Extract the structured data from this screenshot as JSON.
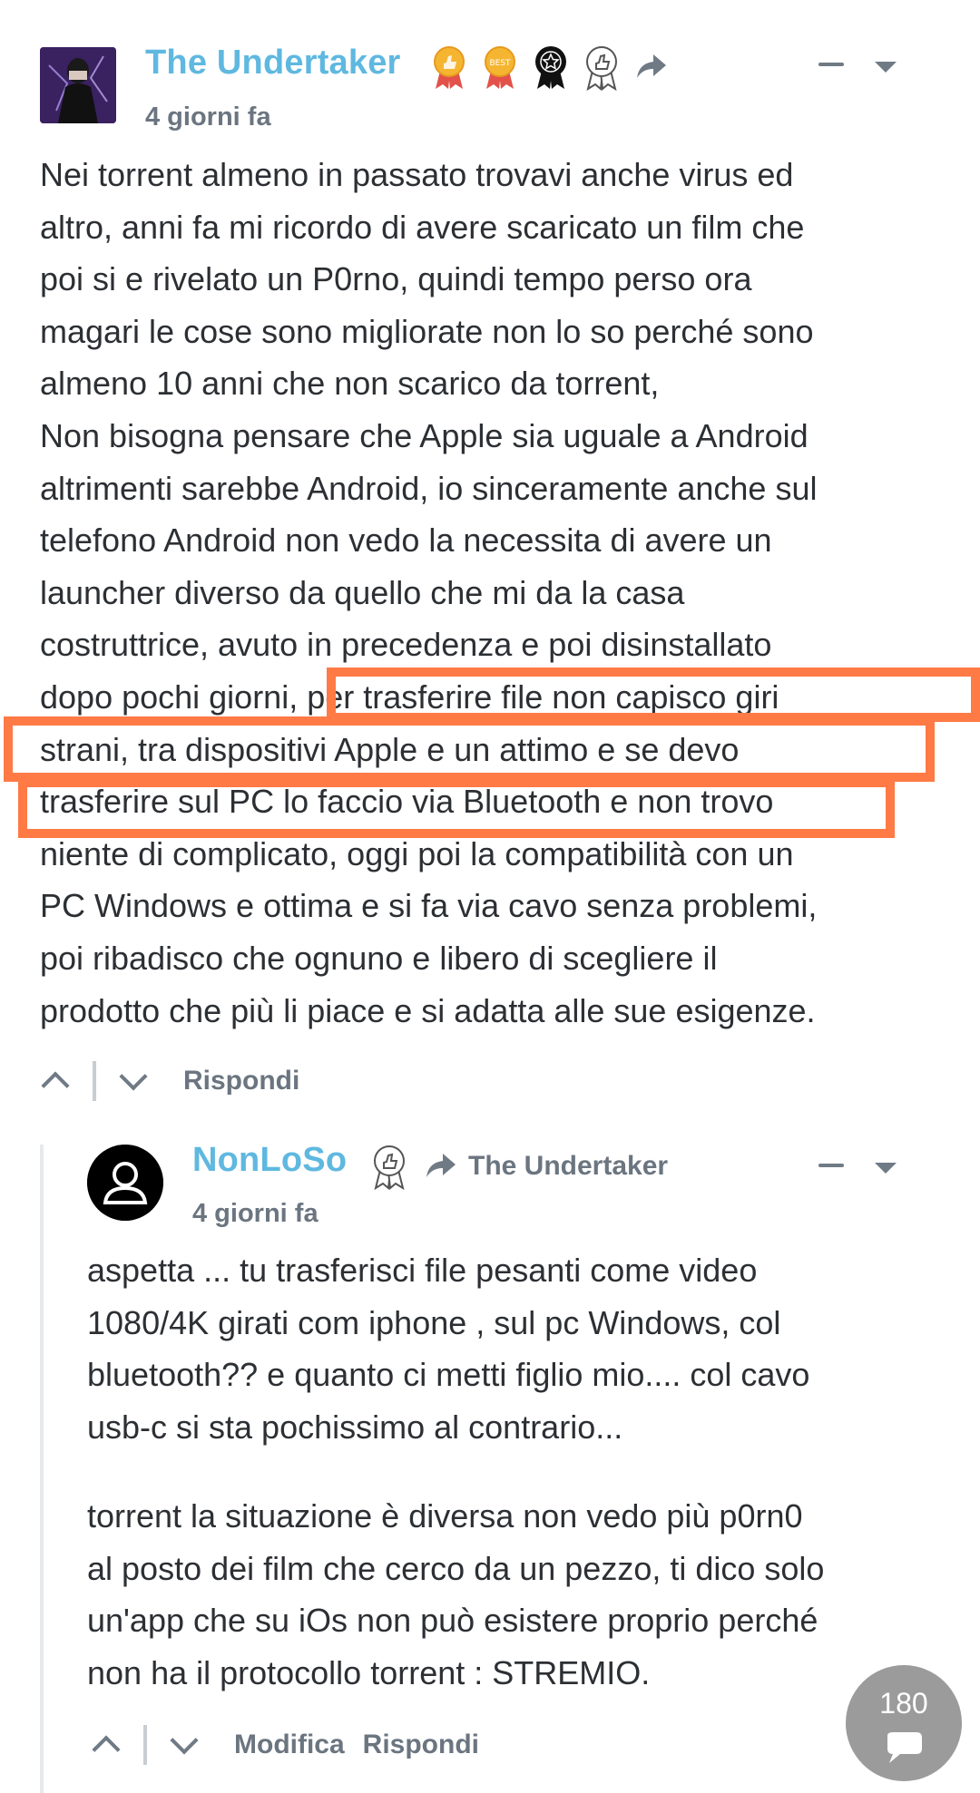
{
  "comment1": {
    "author": "The Undertaker",
    "time": "4 giorni fa",
    "badges": [
      "thumbs-up-medal-icon",
      "best-medal-icon",
      "star-rosette-icon",
      "like-rosette-icon"
    ],
    "lines": [
      "Nei torrent almeno in passato trovavi anche virus ed",
      "altro, anni fa mi ricordo di avere scaricato un film che",
      "poi si e rivelato un P0rno, quindi tempo perso ora",
      "magari le cose sono migliorate non lo so perché sono",
      "almeno 10 anni che non scarico da torrent,",
      "Non bisogna pensare che Apple sia uguale a Android",
      "altrimenti sarebbe Android, io sinceramente anche sul",
      "telefono Android non vedo la necessita di avere un",
      "launcher diverso da quello che mi da la casa",
      "costruttrice, avuto in precedenza e poi disinstallato",
      "dopo pochi giorni, per trasferire file non capisco giri",
      "strani, tra dispositivi Apple e un attimo e se devo",
      "trasferire sul PC lo faccio via Bluetooth e non trovo",
      "niente di complicato, oggi poi la compatibilità con un",
      "PC Windows e ottima e si fa via cavo senza problemi,",
      "poi ribadisco che ognuno e libero di scegliere il",
      "prodotto che più li piace e si adatta alle sue esigenze."
    ],
    "reply_label": "Rispondi"
  },
  "comment2": {
    "author": "NonLoSo",
    "reply_to": "The Undertaker",
    "time": "4 giorni fa",
    "paragraph1": [
      "aspetta ... tu trasferisci file pesanti come video",
      "1080/4K girati com iphone , sul pc Windows, col",
      "bluetooth?? e quanto ci metti figlio mio.... col cavo",
      "usb-c si sta pochissimo al contrario..."
    ],
    "paragraph2": [
      "torrent la situazione è diversa non vedo più p0rn0",
      "al posto dei film che cerco da un pezzo, ti dico solo",
      "un'app che su iOs non può esistere proprio perché",
      "non ha il protocollo torrent : STREMIO."
    ],
    "edit_label": "Modifica",
    "reply_label": "Rispondi"
  },
  "comment_count": "180",
  "colors": {
    "author": "#5fb8e0",
    "highlight": "#ff7a45",
    "muted": "#6b7580",
    "bubble": "#9b9b9b"
  }
}
